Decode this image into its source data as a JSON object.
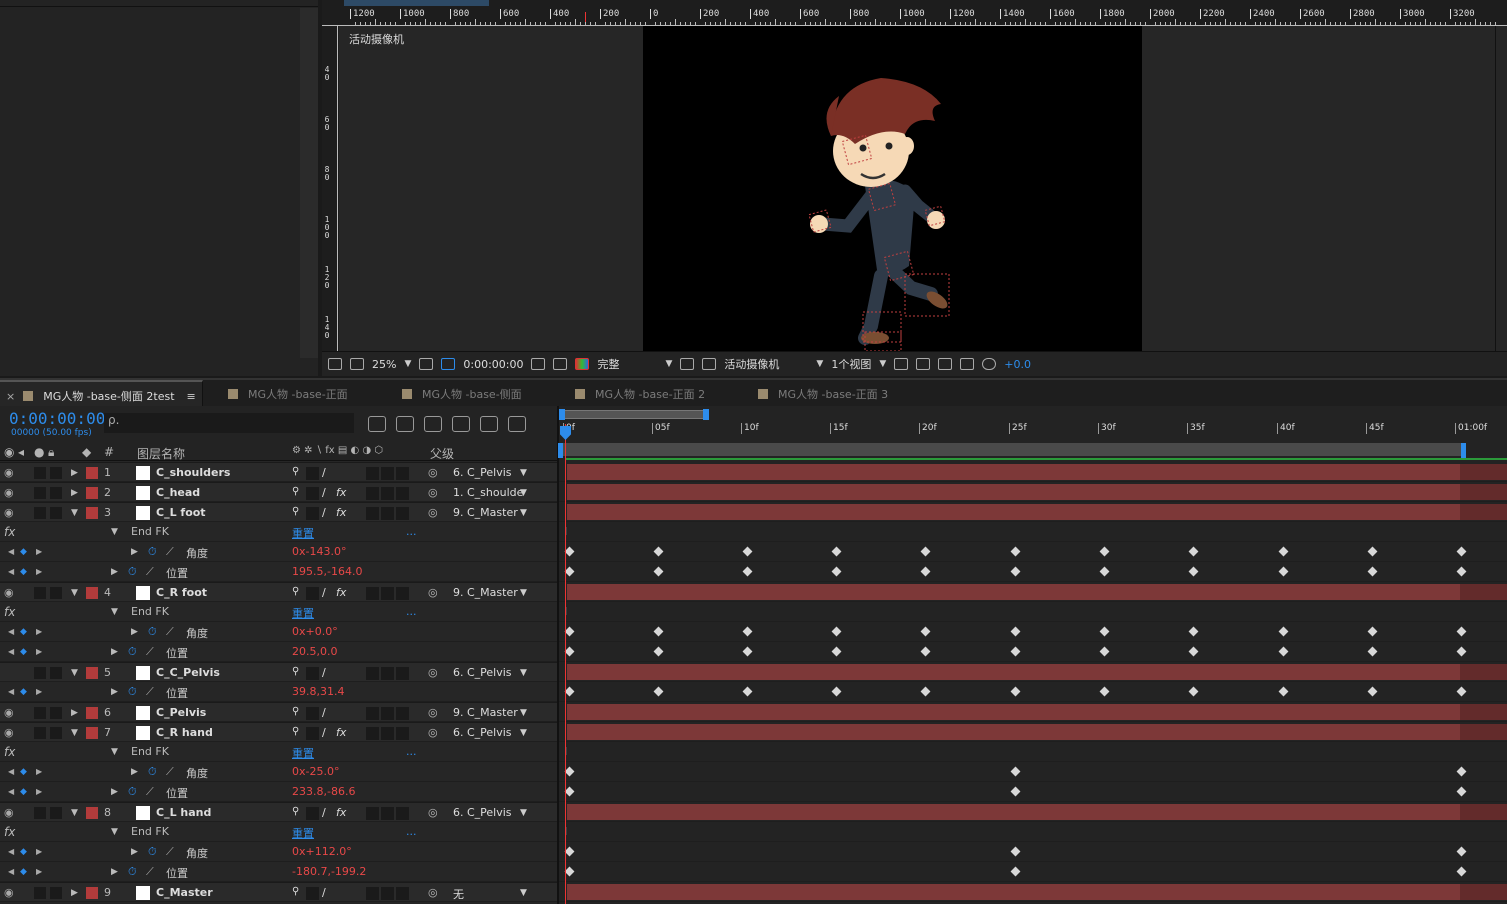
{
  "viewer": {
    "camera_label": "活动摄像机",
    "ruler_numbers": [
      "1200",
      "1000",
      "800",
      "600",
      "400",
      "200",
      "0",
      "200",
      "400",
      "600",
      "800",
      "1000",
      "1200",
      "1400",
      "1600",
      "1800",
      "2000",
      "2200",
      "2400",
      "2600",
      "2800",
      "3000",
      "3200"
    ],
    "vruler": [
      "4\n0",
      "6\n0",
      "8\n0",
      "1\n0\n0",
      "1\n2\n0",
      "1\n4\n0"
    ],
    "zoom": "25%",
    "time": "0:00:00:00",
    "resolution": "完整",
    "camera": "活动摄像机",
    "views": "1个视图",
    "exposure": "+0.0"
  },
  "tabs": [
    {
      "label": "MG人物 -base-侧面 2test",
      "active": true
    },
    {
      "label": "MG人物 -base-正面",
      "active": false
    },
    {
      "label": "MG人物 -base-侧面",
      "active": false
    },
    {
      "label": "MG人物 -base-正面 2",
      "active": false
    },
    {
      "label": "MG人物 -base-正面 3",
      "active": false
    }
  ],
  "timeline": {
    "timecode": "0:00:00:00",
    "fps": "00000 (50.00 fps)",
    "search_placeholder": "ρ.",
    "col_name": "图层名称",
    "col_parent": "父级",
    "col_num": "#",
    "ticks": [
      "0f",
      "05f",
      "10f",
      "15f",
      "20f",
      "25f",
      "30f",
      "35f",
      "40f",
      "45f",
      "01:00f"
    ]
  },
  "rows": [
    {
      "t": "layer",
      "num": "1",
      "name": "C_shoulders",
      "fx": false,
      "parent": "6. C_Pelvis",
      "open": false
    },
    {
      "t": "layer",
      "num": "2",
      "name": "C_head",
      "fx": true,
      "parent": "1. C_shoulde",
      "open": false
    },
    {
      "t": "layer",
      "num": "3",
      "name": "C_L foot",
      "fx": true,
      "parent": "9. C_Master",
      "open": true
    },
    {
      "t": "effect",
      "name": "End FK",
      "reset": "重置"
    },
    {
      "t": "prop",
      "name": "角度",
      "value": "0x-143.0°",
      "sub": true,
      "keys": "full"
    },
    {
      "t": "prop",
      "name": "位置",
      "value": "195.5,-164.0",
      "sub": false,
      "keys": "full"
    },
    {
      "t": "layer",
      "num": "4",
      "name": "C_R foot",
      "fx": true,
      "parent": "9. C_Master",
      "open": true
    },
    {
      "t": "effect",
      "name": "End FK",
      "reset": "重置"
    },
    {
      "t": "prop",
      "name": "角度",
      "value": "0x+0.0°",
      "sub": true,
      "keys": "full"
    },
    {
      "t": "prop",
      "name": "位置",
      "value": "20.5,0.0",
      "sub": false,
      "keys": "full"
    },
    {
      "t": "layer",
      "num": "5",
      "name": "C_C_Pelvis",
      "fx": false,
      "parent": "6. C_Pelvis",
      "open": true,
      "noeye": true
    },
    {
      "t": "prop",
      "name": "位置",
      "value": "39.8,31.4",
      "sub": false,
      "keys": "full"
    },
    {
      "t": "layer",
      "num": "6",
      "name": "C_Pelvis",
      "fx": false,
      "parent": "9. C_Master",
      "open": false
    },
    {
      "t": "layer",
      "num": "7",
      "name": "C_R hand",
      "fx": true,
      "parent": "6. C_Pelvis",
      "open": true
    },
    {
      "t": "effect",
      "name": "End FK",
      "reset": "重置"
    },
    {
      "t": "prop",
      "name": "角度",
      "value": "0x-25.0°",
      "sub": true,
      "keys": "sparse"
    },
    {
      "t": "prop",
      "name": "位置",
      "value": "233.8,-86.6",
      "sub": false,
      "keys": "sparse"
    },
    {
      "t": "layer",
      "num": "8",
      "name": "C_L hand",
      "fx": true,
      "parent": "6. C_Pelvis",
      "open": true
    },
    {
      "t": "effect",
      "name": "End FK",
      "reset": "重置"
    },
    {
      "t": "prop",
      "name": "角度",
      "value": "0x+112.0°",
      "sub": true,
      "keys": "sparse"
    },
    {
      "t": "prop",
      "name": "位置",
      "value": "-180.7,-199.2",
      "sub": false,
      "keys": "sparse"
    },
    {
      "t": "layer",
      "num": "9",
      "name": "C_Master",
      "fx": false,
      "parent": "无",
      "open": false
    }
  ],
  "colors": {
    "accent": "#2d8ceb",
    "layer_bar": "#7d3838",
    "value_red": "#e84848",
    "label_red": "#b23b3b"
  },
  "icons": [
    "eye-icon",
    "speaker-icon",
    "solo-icon",
    "lock-icon",
    "label-icon",
    "stopwatch-icon",
    "graph-icon",
    "parent-pickwhip-icon",
    "keyframe-icon",
    "camera-icon",
    "search-icon"
  ]
}
